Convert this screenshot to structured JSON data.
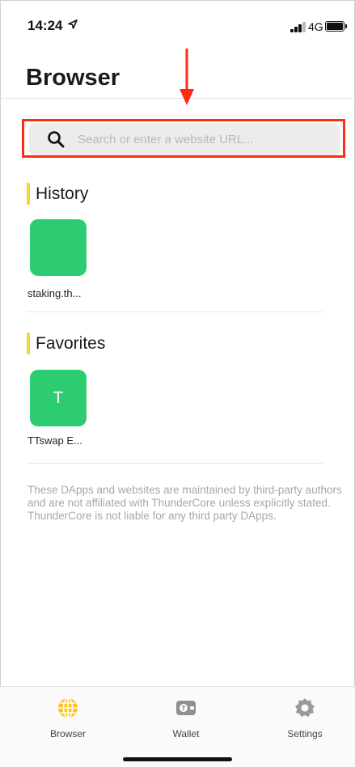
{
  "status_bar": {
    "time": "14:24",
    "network": "4G"
  },
  "page": {
    "title": "Browser"
  },
  "search": {
    "placeholder": "Search or enter a website URL..."
  },
  "history": {
    "title": "History",
    "items": [
      {
        "label": "staking.th...",
        "initial": ""
      }
    ]
  },
  "favorites": {
    "title": "Favorites",
    "items": [
      {
        "label": "TTswap E...",
        "initial": "T"
      }
    ]
  },
  "disclaimer": "These DApps and websites are maintained by third-party authors and are not affiliated with ThunderCore unless explicitly stated. ThunderCore is not liable for any third party DApps.",
  "tabbar": {
    "tabs": [
      {
        "label": "Browser",
        "icon": "globe-icon",
        "active": true
      },
      {
        "label": "Wallet",
        "icon": "wallet-icon",
        "active": false
      },
      {
        "label": "Settings",
        "icon": "gear-icon",
        "active": false
      }
    ]
  },
  "colors": {
    "accent": "#ffc31f",
    "tile_green": "#2ecc71",
    "section_bar": "#ffd428",
    "highlight_red": "#ff2a12"
  }
}
